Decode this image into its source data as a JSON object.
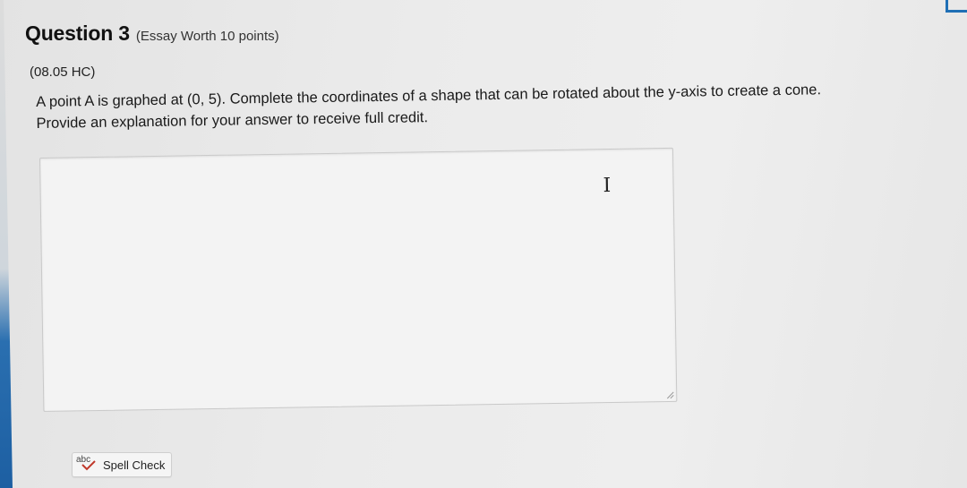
{
  "question": {
    "title": "Question 3",
    "worth": "(Essay Worth 10 points)",
    "code": "(08.05 HC)",
    "body_line1": "A point A is graphed at (0, 5). Complete the coordinates of a shape that can be rotated about the y-axis to create a cone.",
    "body_line2": "Provide an explanation for your answer to receive full credit."
  },
  "answer": {
    "value": "",
    "placeholder": ""
  },
  "toolbar": {
    "spell_icon_text": "abc",
    "spell_check_label": "Spell Check"
  },
  "colors": {
    "accent": "#1f6fb5",
    "spell_check_mark": "#c0392b"
  },
  "icons": {
    "cursor": "text-cursor-icon",
    "spell": "spell-check-icon"
  }
}
